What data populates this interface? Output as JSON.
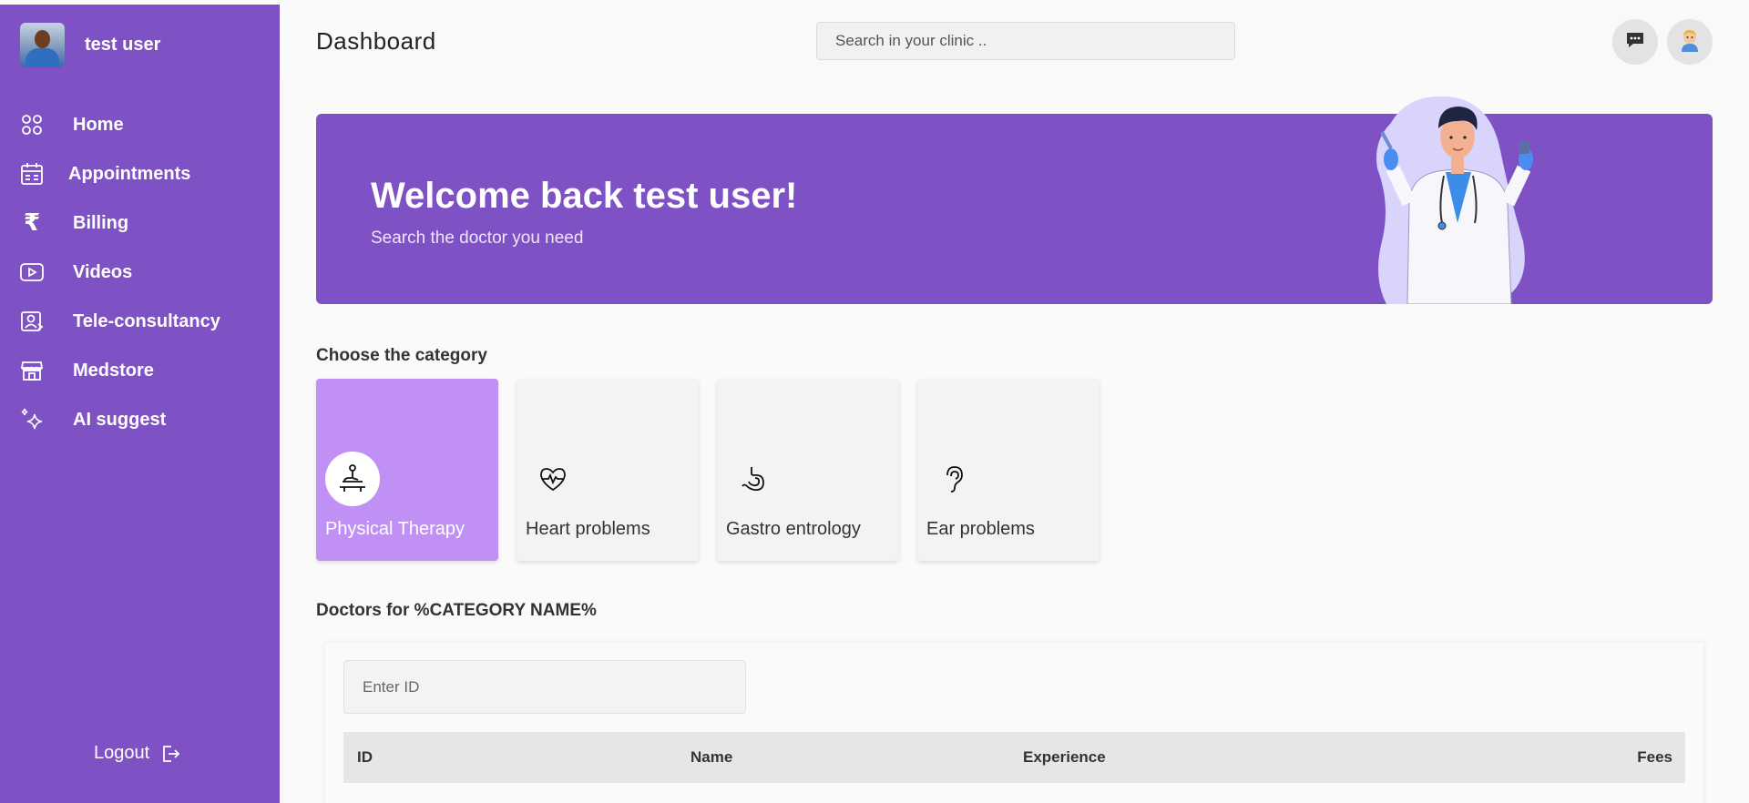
{
  "user": {
    "name": "test user"
  },
  "sidebar": {
    "items": [
      {
        "label": "Home",
        "icon": "grid-circles-icon"
      },
      {
        "label": "Appointments",
        "icon": "calendar-icon"
      },
      {
        "label": "Billing",
        "icon": "rupee-icon"
      },
      {
        "label": "Videos",
        "icon": "video-play-icon"
      },
      {
        "label": "Tele-consultancy",
        "icon": "tele-consult-icon"
      },
      {
        "label": "Medstore",
        "icon": "store-icon"
      },
      {
        "label": "AI suggest",
        "icon": "sparkle-icon"
      }
    ],
    "logout_label": "Logout"
  },
  "header": {
    "title": "Dashboard",
    "search_placeholder": "Search in your clinic .."
  },
  "hero": {
    "title": "Welcome back test user!",
    "subtitle": "Search the doctor you need"
  },
  "categories": {
    "heading": "Choose the category",
    "items": [
      {
        "label": "Physical Therapy",
        "icon": "physiotherapy-icon",
        "active": true
      },
      {
        "label": "Heart problems",
        "icon": "heart-pulse-icon",
        "active": false
      },
      {
        "label": "Gastro entrology",
        "icon": "stomach-icon",
        "active": false
      },
      {
        "label": "Ear problems",
        "icon": "ear-icon",
        "active": false
      }
    ]
  },
  "doctors": {
    "heading": "Doctors for %CATEGORY NAME%",
    "id_placeholder": "Enter ID",
    "columns": [
      "ID",
      "Name",
      "Experience",
      "Fees"
    ]
  },
  "colors": {
    "brand": "#7e52c5",
    "active_category": "#c090f5"
  }
}
